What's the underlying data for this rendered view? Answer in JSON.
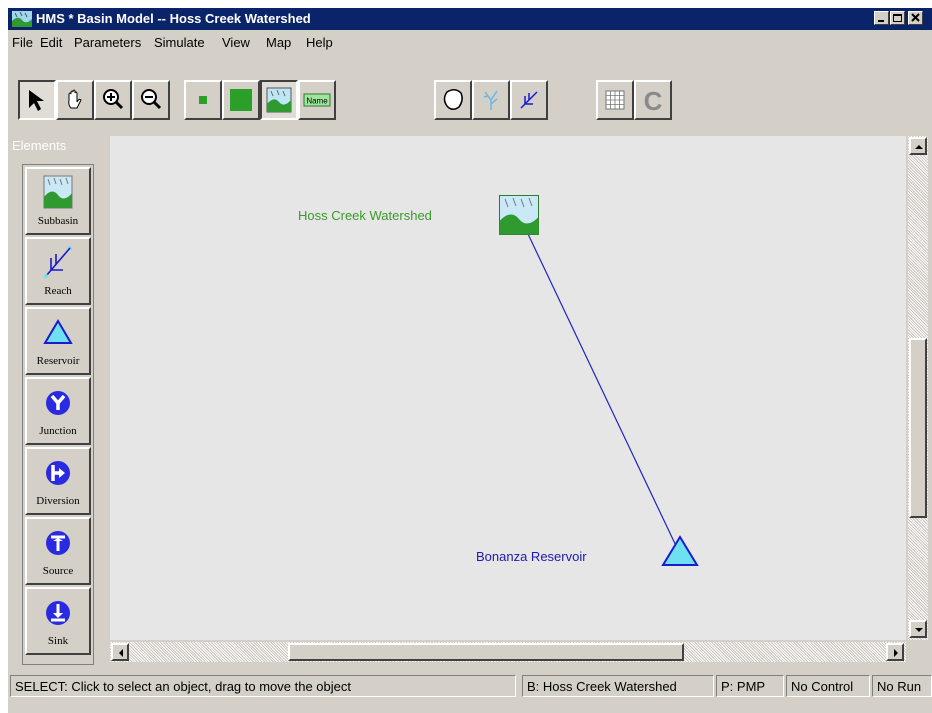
{
  "window": {
    "title": "HMS * Basin Model -- Hoss Creek Watershed",
    "title_color": "#0a246a"
  },
  "menu": [
    {
      "label": "File"
    },
    {
      "label": "Edit"
    },
    {
      "label": "Parameters"
    },
    {
      "label": "Simulate"
    },
    {
      "label": "View"
    },
    {
      "label": "Map"
    },
    {
      "label": "Help"
    }
  ],
  "toolbar": {
    "tools": [
      {
        "icon": "select-arrow-icon",
        "pressed": true
      },
      {
        "icon": "pan-hand-icon"
      },
      {
        "icon": "zoom-in-icon"
      },
      {
        "icon": "zoom-out-icon"
      },
      {
        "icon": "small-icon-size-icon"
      },
      {
        "icon": "large-icon-size-icon"
      },
      {
        "icon": "show-element-icon-icon",
        "pressed": true
      },
      {
        "icon": "show-name-icon",
        "text": "Name"
      },
      {
        "icon": "basin-boundary-icon"
      },
      {
        "icon": "stream-network-icon"
      },
      {
        "icon": "reach-toggle-icon"
      },
      {
        "icon": "grid-icon"
      },
      {
        "icon": "clear-icon"
      }
    ]
  },
  "palette": {
    "title": "Elements",
    "items": [
      {
        "label": "Subbasin",
        "icon": "subbasin-icon"
      },
      {
        "label": "Reach",
        "icon": "reach-icon"
      },
      {
        "label": "Reservoir",
        "icon": "reservoir-icon"
      },
      {
        "label": "Junction",
        "icon": "junction-icon"
      },
      {
        "label": "Diversion",
        "icon": "diversion-icon"
      },
      {
        "label": "Source",
        "icon": "source-icon"
      },
      {
        "label": "Sink",
        "icon": "sink-icon"
      }
    ]
  },
  "canvas": {
    "background": "#e6e6e6",
    "nodes": [
      {
        "name": "Hoss Creek Watershed",
        "type": "subbasin",
        "label_color": "#3a9a2a"
      },
      {
        "name": "Bonanza Reservoir",
        "type": "reservoir",
        "label_color": "#1a1ab0"
      }
    ],
    "link_color": "#2222cc"
  },
  "status": {
    "message": "SELECT: Click to select an object, drag to move the object",
    "basin": "B: Hoss Creek Watershed",
    "precip": "P: PMP",
    "control": "No Control",
    "run": "No Run"
  }
}
